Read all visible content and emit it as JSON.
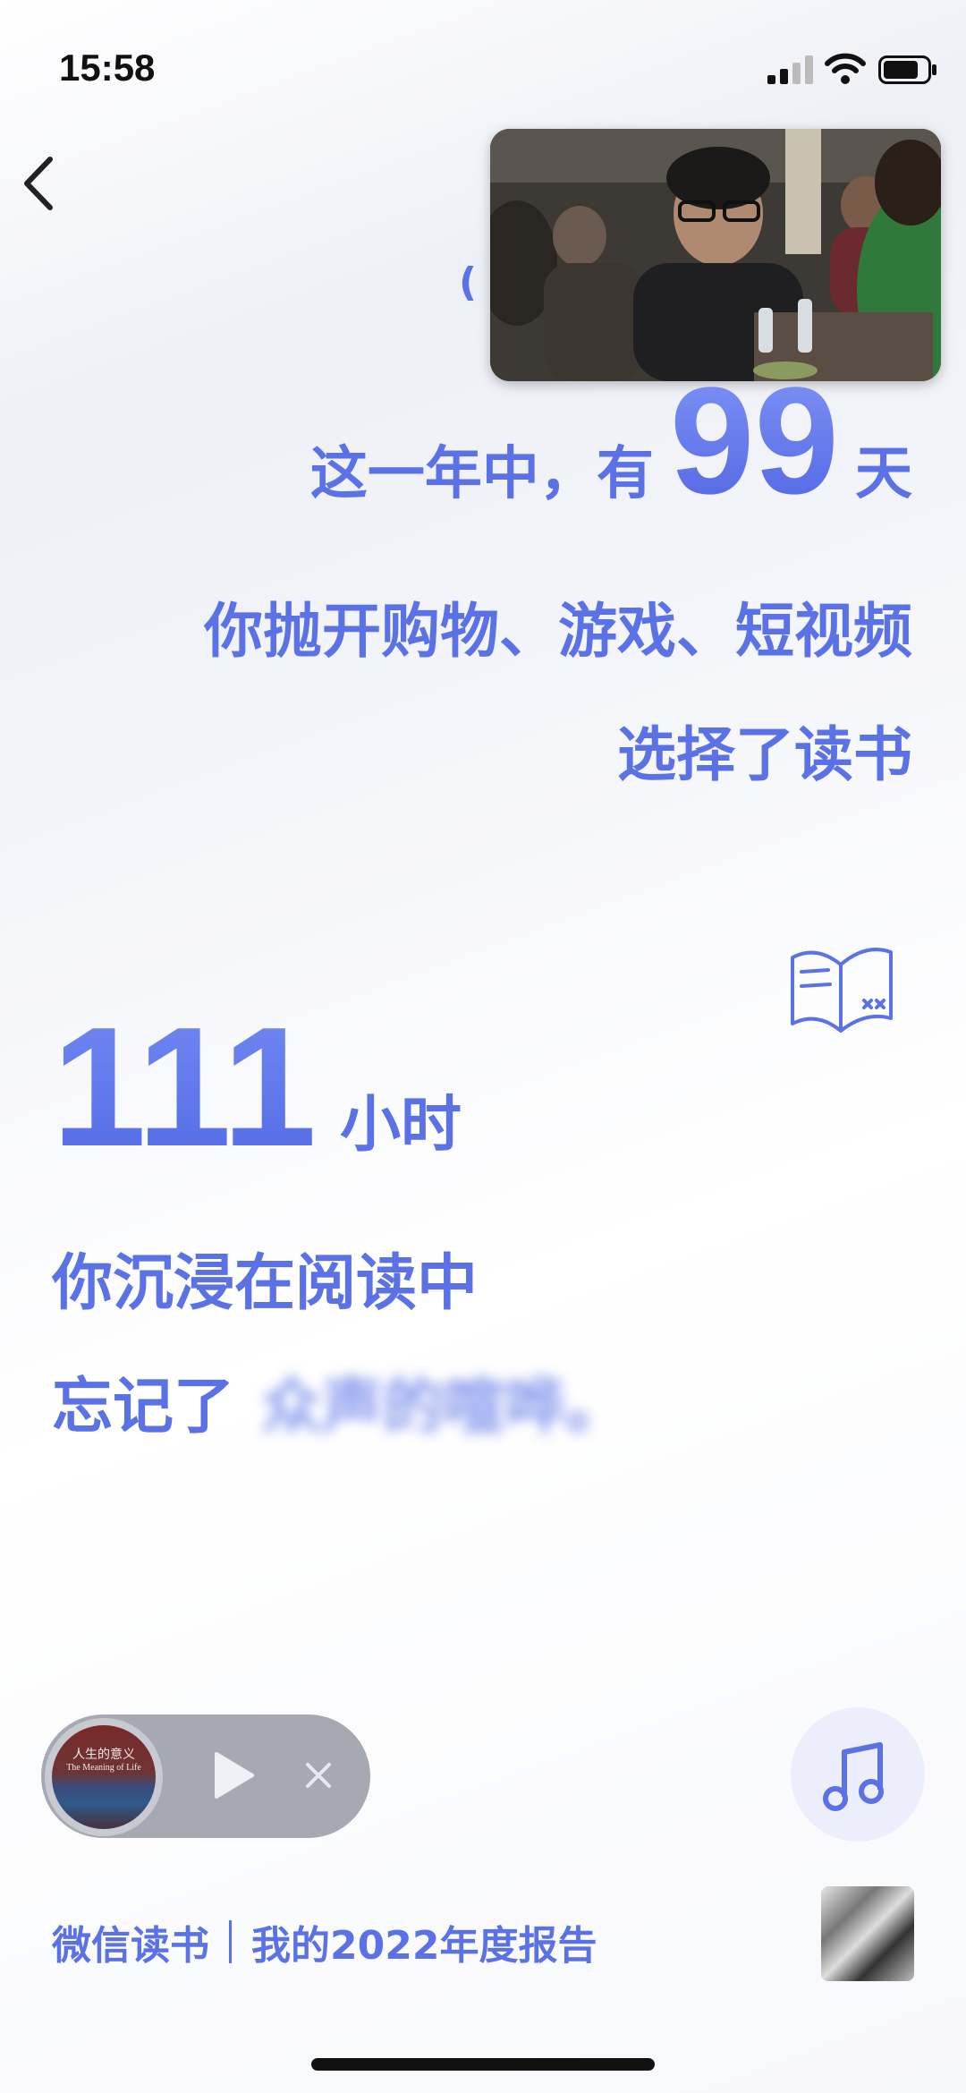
{
  "status_bar": {
    "time": "15:58"
  },
  "video": {
    "description_icon": "video-thumbnail"
  },
  "paren": "(",
  "stats": {
    "line1_prefix": "这一年中，有",
    "days": "99",
    "days_unit": "天",
    "line2": "你抛开购物、游戏、短视频",
    "line3": "选择了读书",
    "hours": "111",
    "hours_unit": "小时",
    "line4": "你沉浸在阅读中",
    "line5_prefix": "忘记了",
    "line5_blurred": "众声的喧哗。"
  },
  "player": {
    "cover_title_cn": "人生的意义",
    "cover_title_en": "The Meaning of Life"
  },
  "footer": {
    "brand": "微信读书",
    "report": "我的2022年度报告"
  },
  "colors": {
    "accent": "#5a72e6"
  }
}
